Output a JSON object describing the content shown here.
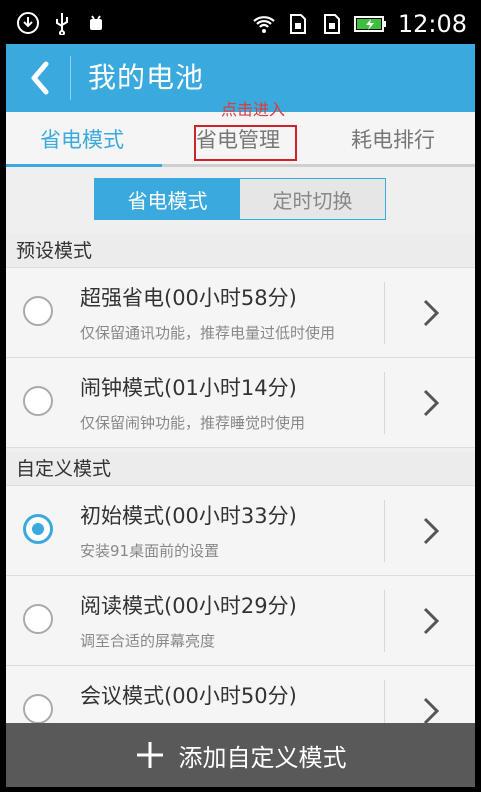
{
  "statusbar": {
    "time": "12:08",
    "icons_left": [
      "download-icon",
      "usb-icon",
      "android-debug-icon"
    ],
    "icons_right": [
      "wifi-icon",
      "sim-icon",
      "sim-icon",
      "battery-charging-icon"
    ]
  },
  "titlebar": {
    "title": "我的电池"
  },
  "tabs": [
    {
      "label": "省电模式",
      "active": true
    },
    {
      "label": "省电管理",
      "active": false
    },
    {
      "label": "耗电排行",
      "active": false
    }
  ],
  "annotation": {
    "label": "点击进入"
  },
  "segmented": {
    "left": "省电模式",
    "right": "定时切换"
  },
  "sections": {
    "preset": "预设模式",
    "custom": "自定义模式"
  },
  "items": [
    {
      "title": "超强省电(00小时58分)",
      "sub": "仅保留通讯功能，推荐电量过低时使用",
      "checked": false
    },
    {
      "title": "闹钟模式(01小时14分)",
      "sub": "仅保留闹钟功能，推荐睡觉时使用",
      "checked": false
    },
    {
      "title": "初始模式(00小时33分)",
      "sub": "安装91桌面前的设置",
      "checked": true
    },
    {
      "title": "阅读模式(00小时29分)",
      "sub": "调至合适的屏幕亮度",
      "checked": false
    },
    {
      "title": "会议模式(00小时50分)",
      "sub": "",
      "checked": false
    }
  ],
  "bottom": {
    "label": "添加自定义模式"
  },
  "colors": {
    "accent": "#3aa9dd",
    "annotation": "#d0222a",
    "bottom": "#595959"
  }
}
